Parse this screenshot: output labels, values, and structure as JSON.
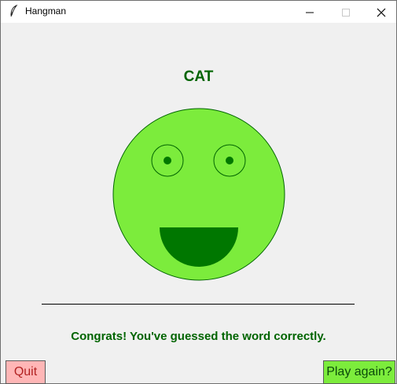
{
  "window": {
    "title": "Hangman",
    "icon": "feather-icon",
    "controls": [
      "minimize-icon",
      "maximize-icon",
      "close-icon"
    ]
  },
  "game": {
    "word": "CAT",
    "message": "Congrats! You've guessed the word correctly.",
    "face": "smiley-face"
  },
  "buttons": {
    "quit_label": "Quit",
    "play_again_label": "Play again?"
  },
  "colors": {
    "text_green": "#006400",
    "face_green": "#7cec3c",
    "mouth_green": "#007700",
    "quit_bg": "#ffb6b6",
    "play_bg": "#7cec3c",
    "window_bg": "#f0f0f0"
  }
}
